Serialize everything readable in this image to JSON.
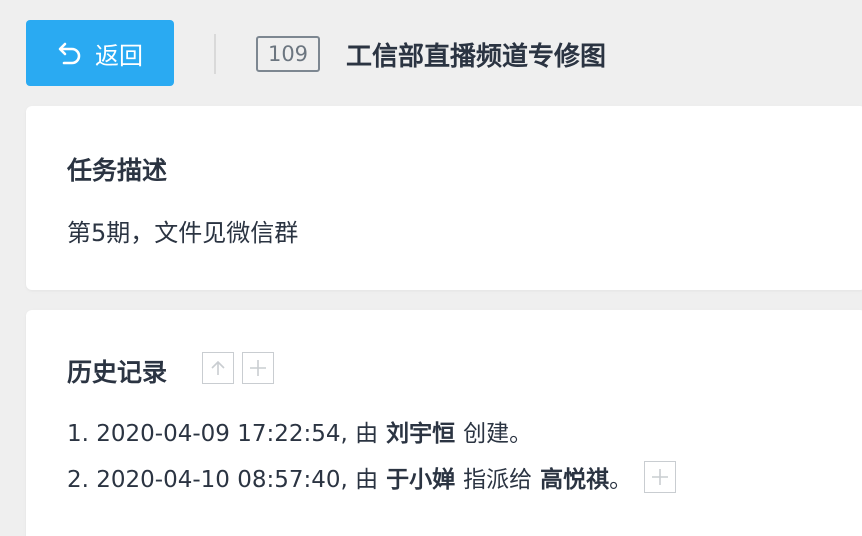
{
  "header": {
    "back_label": "返回",
    "task_id": "109",
    "task_title": "工信部直播频道专修图"
  },
  "description": {
    "title": "任务描述",
    "text": "第5期，文件见微信群"
  },
  "history": {
    "title": "历史记录",
    "entries": [
      {
        "prefix": "1. 2020-04-09 17:22:54, 由",
        "actor": "刘宇恒",
        "action": "创建。"
      },
      {
        "prefix": "2. 2020-04-10 08:57:40, 由",
        "actor": "于小婵",
        "action": "指派给",
        "target": "高悦祺",
        "suffix": "。"
      }
    ]
  },
  "colors": {
    "accent": "#2aaaf2",
    "background": "#efefef",
    "text": "#2b3442",
    "border": "#c9cdd1"
  },
  "icons": [
    "back-arrow-icon",
    "arrow-up-icon",
    "plus-icon"
  ]
}
